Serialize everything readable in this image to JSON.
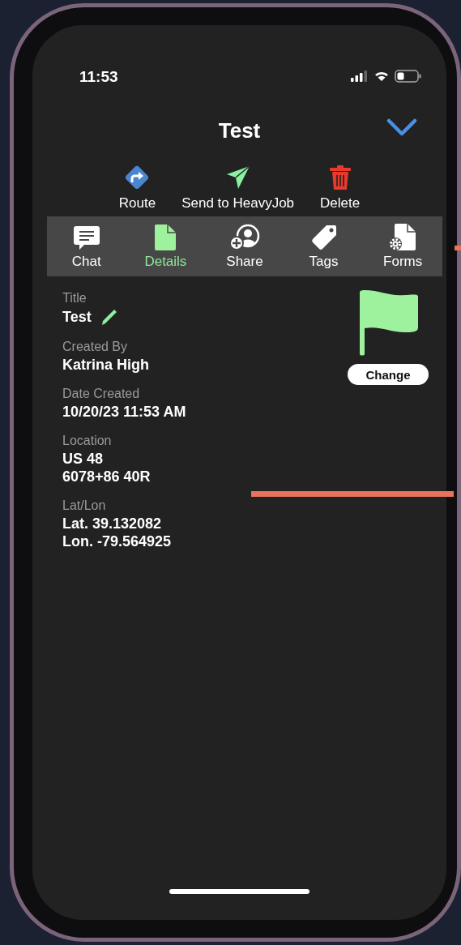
{
  "status_bar": {
    "time": "11:53"
  },
  "header": {
    "title": "Test"
  },
  "actions": [
    {
      "kind": "route",
      "label": "Route"
    },
    {
      "kind": "send",
      "label": "Send to HeavyJob"
    },
    {
      "kind": "delete",
      "label": "Delete"
    }
  ],
  "tabs": [
    {
      "kind": "chat",
      "label": "Chat",
      "selected": false
    },
    {
      "kind": "details",
      "label": "Details",
      "selected": true
    },
    {
      "kind": "share",
      "label": "Share",
      "selected": false
    },
    {
      "kind": "tags",
      "label": "Tags",
      "selected": false
    },
    {
      "kind": "forms",
      "label": "Forms",
      "selected": false
    }
  ],
  "fields": [
    {
      "label": "Title",
      "lines": [
        "Test"
      ],
      "editable": true
    },
    {
      "label": "Created By",
      "lines": [
        "Katrina High"
      ],
      "editable": false
    },
    {
      "label": "Date Created",
      "lines": [
        "10/20/23 11:53 AM"
      ],
      "editable": false
    },
    {
      "label": "Location",
      "lines": [
        "US 48",
        "6078+86 40R"
      ],
      "editable": false
    },
    {
      "label": "Lat/Lon",
      "lines": [
        "Lat. 39.132082",
        "Lon. -79.564925"
      ],
      "editable": false
    }
  ],
  "flag": {
    "button": "Change"
  }
}
